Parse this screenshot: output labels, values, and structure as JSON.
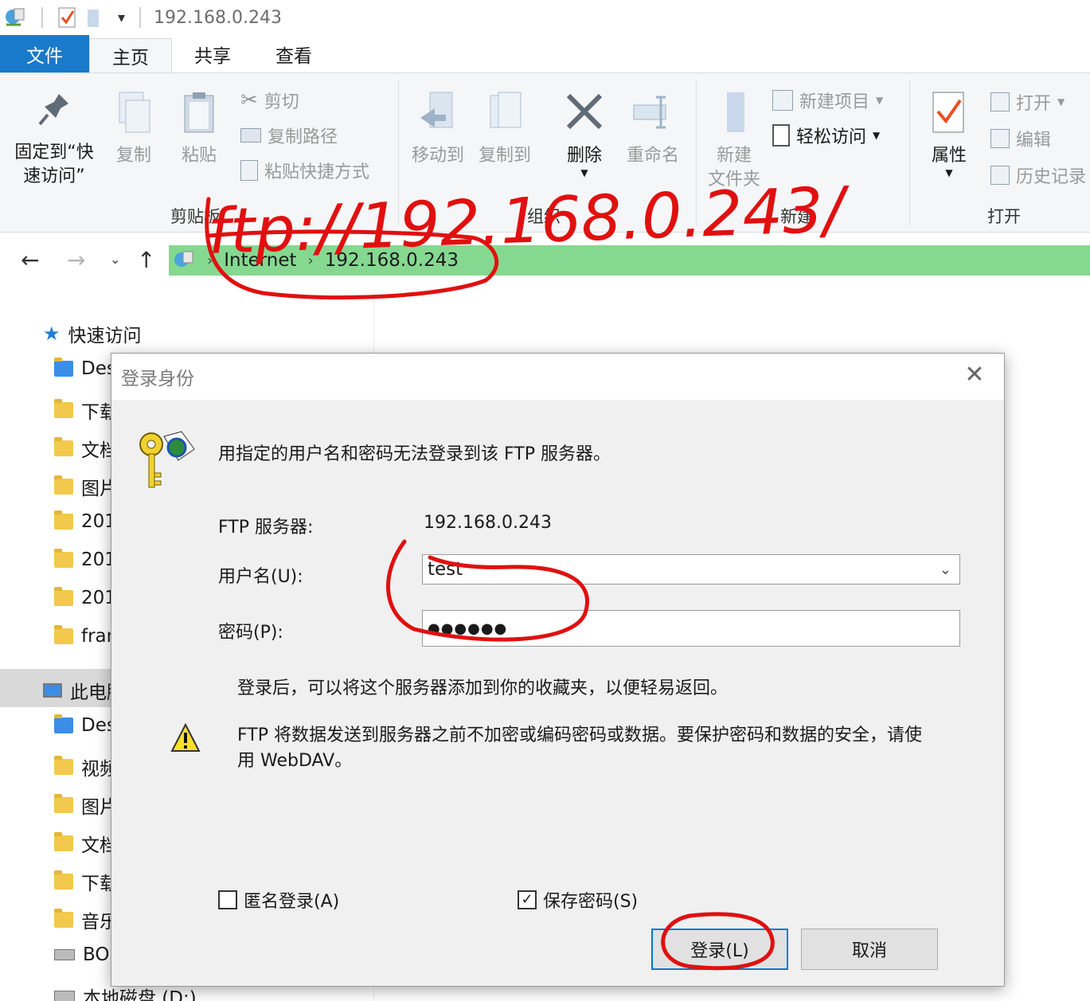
{
  "titlebar": {
    "title": "192.168.0.243"
  },
  "tabs": {
    "file": "文件",
    "home": "主页",
    "share": "共享",
    "view": "查看"
  },
  "ribbon": {
    "pin": "固定到“快\n速访问”",
    "pin_l1": "固定到“快",
    "pin_l2": "速访问”",
    "copy": "复制",
    "paste": "粘贴",
    "cut": "剪切",
    "copy_path": "复制路径",
    "paste_shortcut": "粘贴快捷方式",
    "group_clipboard": "剪贴板",
    "move_to": "移动到",
    "copy_to": "复制到",
    "delete": "删除",
    "rename": "重命名",
    "group_organize": "组织",
    "new_folder_l1": "新建",
    "new_folder_l2": "文件夹",
    "new_item": "新建项目",
    "easy_access": "轻松访问",
    "group_new": "新建",
    "properties": "属性",
    "open": "打开",
    "edit": "编辑",
    "history": "历史记录",
    "group_open": "打开"
  },
  "address": {
    "crumb1": "Internet",
    "crumb2": "192.168.0.243"
  },
  "navpane": {
    "quick_access": "快速访问",
    "items_qa": [
      "Des",
      "下载",
      "文档",
      "图片",
      "201",
      "201",
      "201",
      "fran"
    ],
    "this_pc": "此电脑",
    "items_pc": [
      "Des",
      "视频",
      "图片",
      "文档",
      "下载",
      "音乐",
      "BO",
      "本地磁盘 (D:)"
    ]
  },
  "dialog": {
    "title": "登录身份",
    "message": "用指定的用户名和密码无法登录到该 FTP 服务器。",
    "server_label": "FTP 服务器:",
    "server_value": "192.168.0.243",
    "username_label": "用户名(U):",
    "username_value": "test",
    "password_label": "密码(P):",
    "password_value": "●●●●●●",
    "info": "登录后，可以将这个服务器添加到你的收藏夹，以便轻易返回。",
    "warning_l1": "FTP 将数据发送到服务器之前不加密或编码密码或数据。要保护密码和数据的安全，请使",
    "warning_l2": "用 WebDAV。",
    "anonymous": "匿名登录(A)",
    "anonymous_checked": false,
    "save_password": "保存密码(S)",
    "save_password_checked": true,
    "login_button": "登录(L)",
    "cancel_button": "取消"
  },
  "annotation": {
    "handwritten_text": "ftp://192.168.0.243/",
    "color": "#e01010"
  },
  "colors": {
    "accent": "#1979ca",
    "address_highlight": "#85d890",
    "dialog_bg": "#f0f0f0"
  }
}
